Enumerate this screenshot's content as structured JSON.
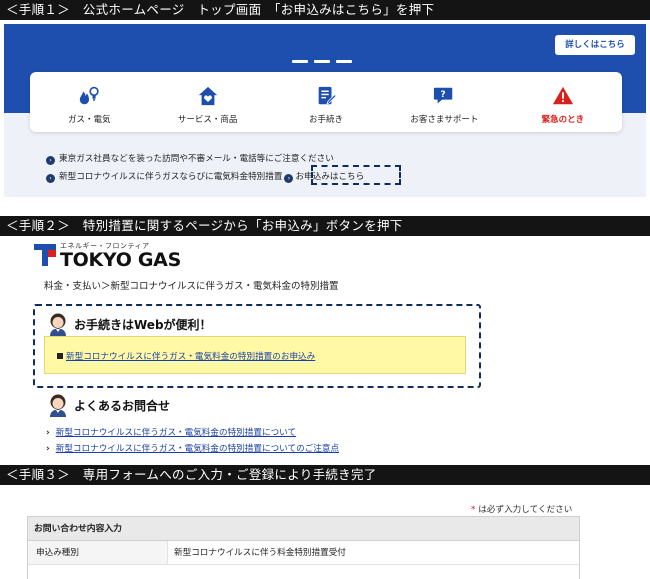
{
  "steps": {
    "step1_label": "＜手順１＞　公式ホームページ　トップ画面　「お申込みはこちら」を押下",
    "step2_label": "＜手順２＞　特別措置に関するページから「お申込み」ボタンを押下",
    "step3_label": "＜手順３＞　専用フォームへのご入力・ご登録により手続き完了"
  },
  "top_page": {
    "detail_button": "詳しくはこちら",
    "menu": [
      {
        "label": "ガス・電気",
        "icon": "gas-electric-icon"
      },
      {
        "label": "サービス・商品",
        "icon": "house-heart-icon"
      },
      {
        "label": "お手続き",
        "icon": "document-pen-icon"
      },
      {
        "label": "お客さまサポート",
        "icon": "chat-question-icon"
      },
      {
        "label": "緊急のとき",
        "icon": "warning-icon"
      }
    ],
    "news": [
      "東京ガス社員などを装った訪問や不審メール・電話等にご注意ください",
      "新型コロナウイルスに伴うガスならびに電気料金特別措置",
      "お申込みはこちら"
    ]
  },
  "special_page": {
    "logo_kana": "エネルギー・フロンティア",
    "logo_text": "TOKYO GAS",
    "breadcrumb": "料金・支払い＞新型コロナウイルスに伴うガス・電気料金の特別措置",
    "web_heading": "お手続きはWebが便利！",
    "apply_link": "新型コロナウイルスに伴うガス・電気料金の特別措置のお申込み",
    "faq_heading": "よくあるお問合せ",
    "faq_links": [
      "新型コロナウイルスに伴うガス・電気料金の特別措置について",
      "新型コロナウイルスに伴うガス・電気料金の特別措置についてのご注意点"
    ]
  },
  "form": {
    "required_note": "は必ず入力してください",
    "required_mark": "*",
    "section_title": "お問い合わせ内容入力",
    "row_label": "申込み種別",
    "row_value": "新型コロナウイルスに伴う料金特別措置受付"
  },
  "colors": {
    "brand_blue": "#1e4fae",
    "emergency_red": "#d8211b",
    "highlight_yellow": "#fff9a6",
    "dash_navy": "#0e2c5e"
  }
}
